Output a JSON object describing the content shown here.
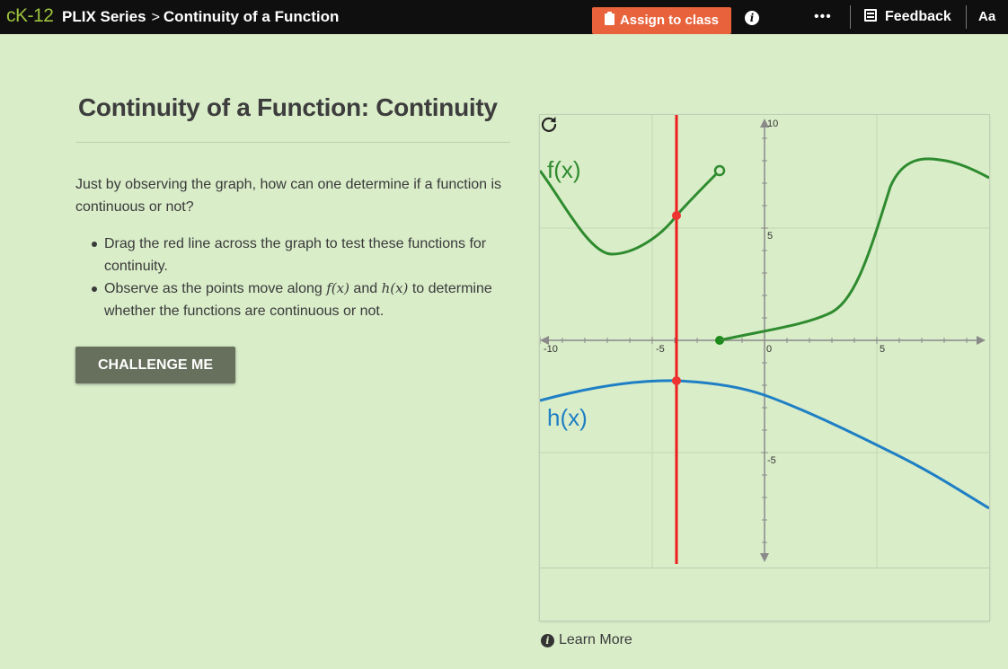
{
  "topbar": {
    "logo_c": "c",
    "logo_k": "K",
    "logo_num": "-12",
    "series": "PLIX Series",
    "separator": ">",
    "page": "Continuity of a Function",
    "assign_label": "Assign to class",
    "info_glyph": "i",
    "more_label": "•••",
    "feedback_label": "Feedback",
    "font_label": "Aa"
  },
  "main": {
    "title": "Continuity of a Function: Continuity",
    "question": "Just by observing the graph, how can one determine if a function is continuous or not?",
    "bullet1": "Drag the red line across the graph to test these functions for continuity.",
    "bullet2_prefix": "Observe as the points move along ",
    "bullet2_f": "f(x)",
    "bullet2_and": " and ",
    "bullet2_h": "h(x)",
    "bullet2_suffix": " to determine whether the functions are continuous or not.",
    "challenge_label": "CHALLENGE ME",
    "learn_more_label": "Learn More",
    "learn_more_glyph": "i"
  },
  "graph": {
    "f_label": "f(x)",
    "h_label": "h(x)",
    "ticks": {
      "xneg10": "-10",
      "xneg5": "-5",
      "x0": "0",
      "x5": "5",
      "y10": "10",
      "y5": "5",
      "yneg5": "-5"
    },
    "colors": {
      "f": "#2e8b2e",
      "h": "#1f7fc4",
      "line": "#ee1c1c",
      "point": "#ee3333"
    },
    "red_line_x": -3.9,
    "x_range": [
      -10,
      10
    ],
    "y_range": [
      -10,
      10
    ]
  }
}
